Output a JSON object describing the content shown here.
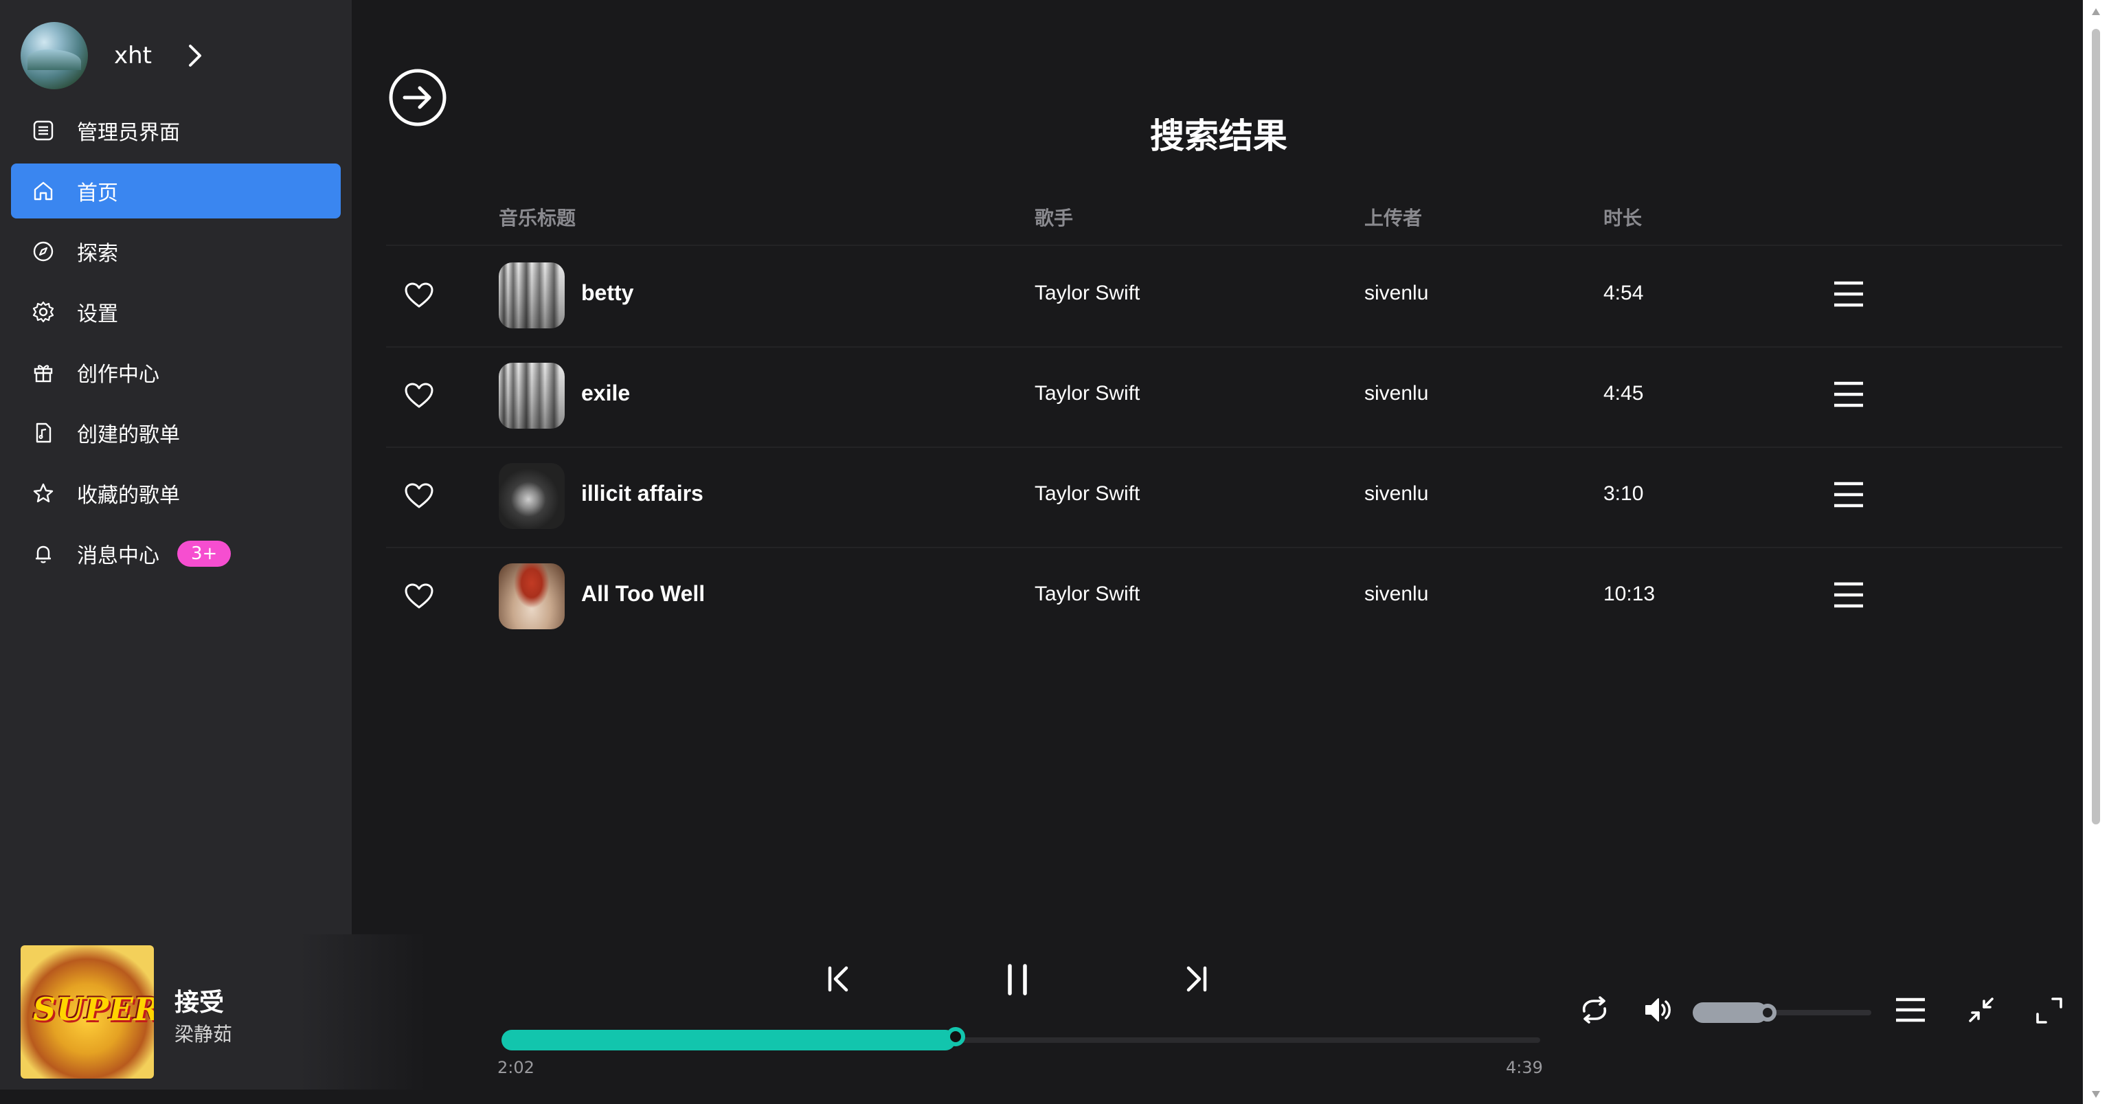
{
  "sidebar": {
    "user_name": "xht",
    "items": [
      {
        "label": "管理员界面",
        "icon": "list-icon"
      },
      {
        "label": "首页",
        "icon": "home-icon",
        "active": true
      },
      {
        "label": "探索",
        "icon": "compass-icon"
      },
      {
        "label": "设置",
        "icon": "gear-icon"
      },
      {
        "label": "创作中心",
        "icon": "gift-icon"
      },
      {
        "label": "创建的歌单",
        "icon": "document-icon"
      },
      {
        "label": "收藏的歌单",
        "icon": "star-icon"
      },
      {
        "label": "消息中心",
        "icon": "bell-icon",
        "badge": "3+"
      }
    ],
    "active_color": "#3a86f0",
    "badge_color": "#f64ed0"
  },
  "main": {
    "title": "搜索结果",
    "columns": {
      "title": "音乐标题",
      "artist": "歌手",
      "uploader": "上传者",
      "duration": "时长"
    },
    "rows": [
      {
        "title": "betty",
        "artist": "Taylor Swift",
        "uploader": "sivenlu",
        "duration": "4:54"
      },
      {
        "title": "exile",
        "artist": "Taylor Swift",
        "uploader": "sivenlu",
        "duration": "4:45"
      },
      {
        "title": "illicit affairs",
        "artist": "Taylor Swift",
        "uploader": "sivenlu",
        "duration": "3:10"
      },
      {
        "title": "All Too Well",
        "artist": "Taylor Swift",
        "uploader": "sivenlu",
        "duration": "10:13"
      }
    ]
  },
  "player": {
    "song": "接受",
    "artist": "梁静茹",
    "album_art_text": "SUPER",
    "current_time": "2:02",
    "total_time": "4:39",
    "progress": 0.437,
    "volume": 0.42,
    "accent_color": "#12c5ad"
  }
}
